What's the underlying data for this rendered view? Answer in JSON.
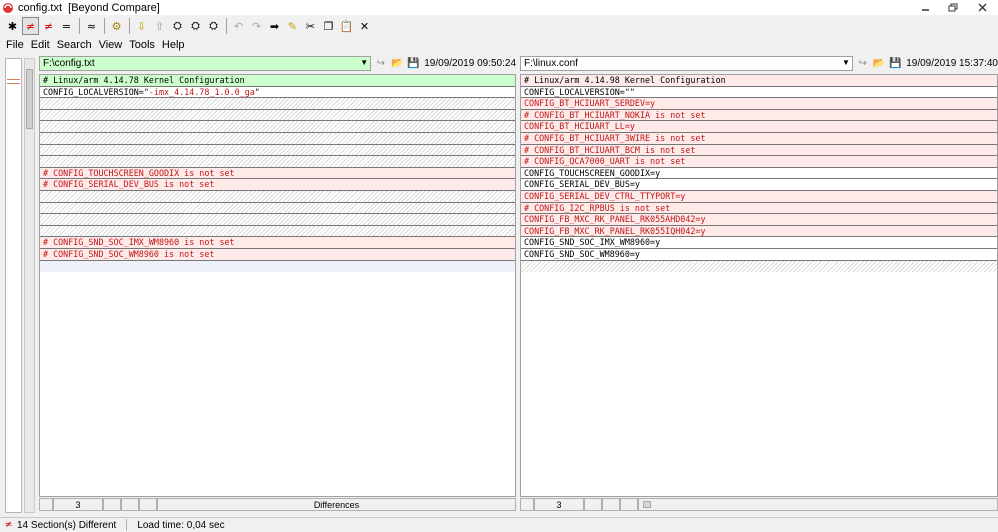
{
  "window": {
    "title": "config.txt  [Beyond Compare]"
  },
  "toolbar": {
    "buttons": [
      "star-icon",
      "not-equal-icon",
      "not-equal-alt-icon",
      "equals-icon",
      "approx-icon",
      "filter-icon",
      "down-arrow-icon",
      "up-arrow-icon",
      "binoculars-icon",
      "binoculars-next-icon",
      "binoculars-prev-icon",
      "undo-icon",
      "redo-icon",
      "right-arrow-icon",
      "edit-icon",
      "cut-icon",
      "copy-icon",
      "paste-icon",
      "close-x-icon"
    ]
  },
  "menu": {
    "file": "File",
    "edit": "Edit",
    "search": "Search",
    "view": "View",
    "tools": "Tools",
    "help": "Help"
  },
  "left": {
    "path": "F:\\config.txt",
    "timestamp": "19/09/2019 09:50:24",
    "line_number": "3",
    "status": "Differences",
    "rows": [
      {
        "type": "header",
        "text": "# Linux/arm 4.14.78 Kernel Configuration"
      },
      {
        "type": "diff-partial",
        "prefix": "CONFIG_LOCALVERSION=\"",
        "highlight": "-imx_4.14.78_1.0.0_ga",
        "suffix": "\""
      },
      {
        "type": "blank",
        "text": ""
      },
      {
        "type": "blank",
        "text": ""
      },
      {
        "type": "blank",
        "text": ""
      },
      {
        "type": "blank",
        "text": ""
      },
      {
        "type": "blank",
        "text": ""
      },
      {
        "type": "blank",
        "text": ""
      },
      {
        "type": "diff",
        "text": "# CONFIG_TOUCHSCREEN_GOODIX is not set"
      },
      {
        "type": "diff",
        "text": "# CONFIG_SERIAL_DEV_BUS is not set"
      },
      {
        "type": "blank",
        "text": ""
      },
      {
        "type": "blank",
        "text": ""
      },
      {
        "type": "blank",
        "text": ""
      },
      {
        "type": "blank",
        "text": ""
      },
      {
        "type": "diff",
        "text": "# CONFIG_SND_SOC_IMX_WM8960 is not set"
      },
      {
        "type": "diff",
        "text": "# CONFIG_SND_SOC_WM8960 is not set"
      }
    ]
  },
  "right": {
    "path": "F:\\linux.conf",
    "timestamp": "19/09/2019 15:37:40",
    "line_number": "3",
    "rows": [
      {
        "type": "diff-plain",
        "text": "# Linux/arm 4.14.98 Kernel Configuration"
      },
      {
        "type": "same",
        "text": "CONFIG_LOCALVERSION=\"\""
      },
      {
        "type": "diff",
        "text": "CONFIG_BT_HCIUART_SERDEV=y"
      },
      {
        "type": "diff",
        "text": "# CONFIG_BT_HCIUART_NOKIA is not set"
      },
      {
        "type": "diff",
        "text": "CONFIG_BT_HCIUART_LL=y"
      },
      {
        "type": "diff",
        "text": "# CONFIG_BT_HCIUART_3WIRE is not set"
      },
      {
        "type": "diff",
        "text": "# CONFIG_BT_HCIUART_BCM is not set"
      },
      {
        "type": "diff",
        "text": "# CONFIG_QCA7000_UART is not set"
      },
      {
        "type": "same",
        "text": "CONFIG_TOUCHSCREEN_GOODIX=y"
      },
      {
        "type": "same",
        "text": "CONFIG_SERIAL_DEV_BUS=y"
      },
      {
        "type": "diff",
        "text": "CONFIG_SERIAL_DEV_CTRL_TTYPORT=y"
      },
      {
        "type": "diff",
        "text": "# CONFIG_I2C_RPBUS is not set"
      },
      {
        "type": "diff",
        "text": "CONFIG_FB_MXC_RK_PANEL_RK055AHD042=y"
      },
      {
        "type": "diff",
        "text": "CONFIG_FB_MXC_RK_PANEL_RK055IQH042=y"
      },
      {
        "type": "same",
        "text": "CONFIG_SND_SOC_IMX_WM8960=y"
      },
      {
        "type": "same",
        "text": "CONFIG_SND_SOC_WM8960=y"
      }
    ]
  },
  "statusbar": {
    "sections": "14 Section(s) Different",
    "load_time": "Load time:  0,04 sec"
  }
}
